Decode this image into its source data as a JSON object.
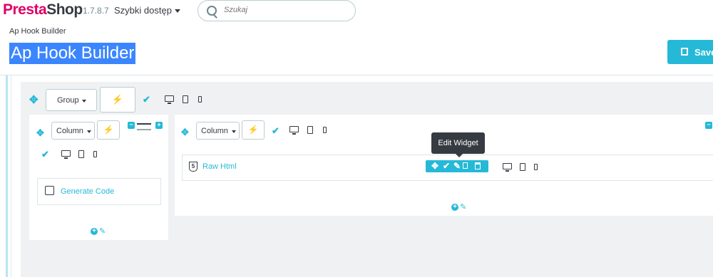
{
  "header": {
    "logo_presta": "Presta",
    "logo_shop": "Shop",
    "version": "1.7.8.7",
    "quick_access": "Szybki dostęp",
    "search_placeholder": "Szukaj"
  },
  "page": {
    "breadcrumb": "Ap Hook Builder",
    "title": "Ap Hook Builder",
    "save_label": "Save"
  },
  "builder": {
    "group_label": "Group",
    "column_left_label": "Column",
    "column_right_label": "Column",
    "generate_code": "Generate Code",
    "widget_label": "Raw Html",
    "tooltip": "Edit Widget"
  },
  "colors": {
    "accent": "#25b9d7",
    "brand_pink": "#df0067",
    "selection": "#3b86ff",
    "dark": "#363a41"
  },
  "icons": [
    "search-icon",
    "move-icon",
    "magic-wand-icon",
    "check-icon",
    "desktop-icon",
    "tablet-icon",
    "phone-icon",
    "html5-icon",
    "pencil-icon",
    "copy-icon",
    "trash-icon",
    "plus-icon",
    "save-icon"
  ]
}
